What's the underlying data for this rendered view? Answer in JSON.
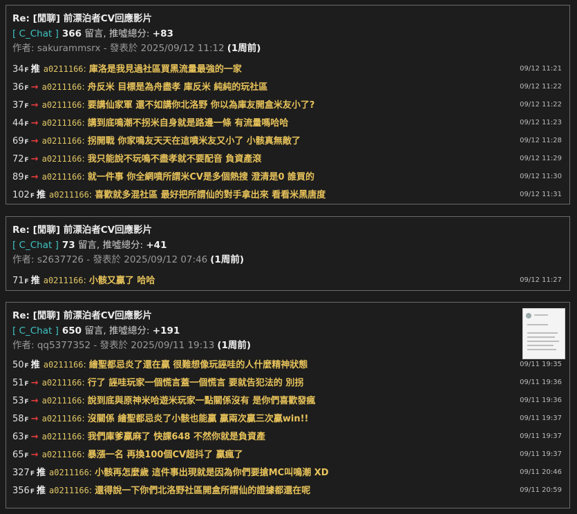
{
  "threads": [
    {
      "title": "Re: [閒聊] 前漂泊者CV回應影片",
      "board": "[ C_Chat ]",
      "comment_count": "366",
      "comment_label": "留言, 推噓總分:",
      "score": "+83",
      "author_prefix": "作者: sakurammsrx - 發表於 2025/09/12 11:12",
      "ago": "(1周前)",
      "pushes": [
        {
          "floor": "34",
          "tag": "推",
          "uid": "a0211166",
          "content": "庫洛是我見過社區買黑流量最強的一家",
          "time": "09/12 11:21"
        },
        {
          "floor": "36",
          "tag": "→",
          "uid": "a0211166",
          "content": "舟反米 目標是為舟盡孝 庫反米 純純的玩社區",
          "time": "09/12 11:22"
        },
        {
          "floor": "37",
          "tag": "→",
          "uid": "a0211166",
          "content": "要講仙家軍 還不如講你北洛野 你以為庫友開盒米友小了?",
          "time": "09/12 11:22"
        },
        {
          "floor": "44",
          "tag": "→",
          "uid": "a0211166",
          "content": "講到底鳴潮不拐米自身就是路邊一條 有流量嗎哈哈",
          "time": "09/12 11:23"
        },
        {
          "floor": "69",
          "tag": "→",
          "uid": "a0211166",
          "content": "拐開戰 你家鳴友天天在這噴米友又小了 小骸真無敵了",
          "time": "09/12 11:28"
        },
        {
          "floor": "72",
          "tag": "→",
          "uid": "a0211166",
          "content": "我只能說不玩鳴不盡孝就不要配音 負資產滾",
          "time": "09/12 11:29"
        },
        {
          "floor": "89",
          "tag": "→",
          "uid": "a0211166",
          "content": "就一件事 你全網噴所謂米CV是多個熱搜 澄清是0 誰買的",
          "time": "09/12 11:30"
        },
        {
          "floor": "102",
          "tag": "推",
          "uid": "a0211166",
          "content": "喜歡就多混社區 最好把所謂仙的對手拿出來 看看米黑唐度",
          "time": "09/12 11:31"
        }
      ]
    },
    {
      "title": "Re: [閒聊] 前漂泊者CV回應影片",
      "board": "[ C_Chat ]",
      "comment_count": "73",
      "comment_label": "留言, 推噓總分:",
      "score": "+41",
      "author_prefix": "作者: s2637726 - 發表於 2025/09/12 07:46",
      "ago": "(1周前)",
      "pushes": [
        {
          "floor": "71",
          "tag": "推",
          "uid": "a0211166",
          "content": "小骸又贏了 哈哈",
          "time": "09/12 11:27"
        }
      ]
    },
    {
      "title": "Re: [閒聊] 前漂泊者CV回應影片",
      "board": "[ C_Chat ]",
      "comment_count": "650",
      "comment_label": "留言, 推噓總分:",
      "score": "+191",
      "author_prefix": "作者: qq5377352 - 發表於 2025/09/11 19:13",
      "ago": "(1周前)",
      "pushes": [
        {
          "floor": "50",
          "tag": "推",
          "uid": "a0211166",
          "content": "繪聖都忌炎了還在贏 很難想像玩誣哇的人什麼精神狀態",
          "time": "09/11 19:35"
        },
        {
          "floor": "51",
          "tag": "→",
          "uid": "a0211166",
          "content": "行了 誣哇玩家一個慌言蓋一個慌言 要就告犯法的 別拐",
          "time": "09/11 19:36"
        },
        {
          "floor": "53",
          "tag": "→",
          "uid": "a0211166",
          "content": "說到底與原神米哈遊米玩家一點關係沒有 是你們喜歡發瘋",
          "time": "09/11 19:36"
        },
        {
          "floor": "58",
          "tag": "→",
          "uid": "a0211166",
          "content": "沒關係 繪聖都忌炎了小骸也能贏 贏兩次贏三次贏win!!",
          "time": "09/11 19:37"
        },
        {
          "floor": "63",
          "tag": "→",
          "uid": "a0211166",
          "content": "我們庫爹贏麻了 快課648 不然你就是負資產",
          "time": "09/11 19:37"
        },
        {
          "floor": "65",
          "tag": "→",
          "uid": "a0211166",
          "content": "暴漲一名 再換100個CV超抖了 贏瘋了",
          "time": "09/11 19:37"
        },
        {
          "floor": "327",
          "tag": "推",
          "uid": "a0211166",
          "content": "小骸再怎麼歲 這件事出現就是因為你們要搶MC叫鳴潮 XD",
          "time": "09/11 20:46"
        },
        {
          "floor": "356",
          "tag": "推",
          "uid": "a0211166",
          "content": "還得說一下你們北洛野社區開盒所謂仙的證據都還在呢",
          "time": "09/11 20:59"
        }
      ]
    }
  ]
}
